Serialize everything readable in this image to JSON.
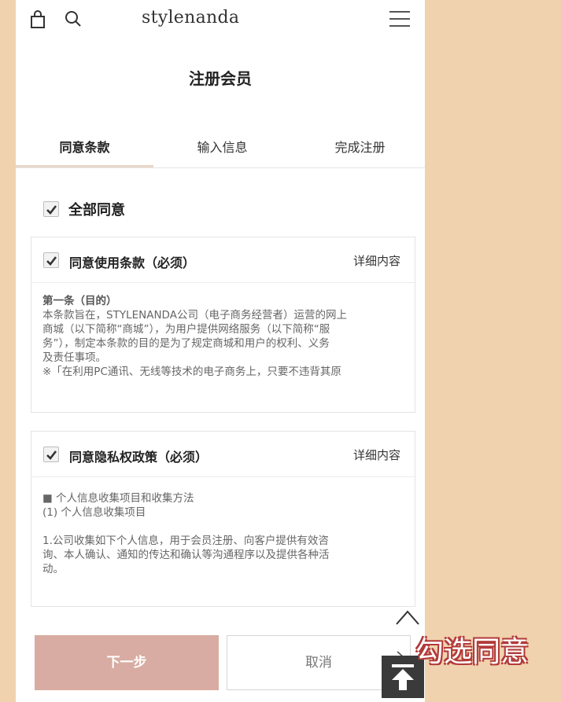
{
  "header": {
    "logo": "stylenanda"
  },
  "page_title": "注册会员",
  "tabs": [
    {
      "label": "同意条款"
    },
    {
      "label": "输入信息"
    },
    {
      "label": "完成注册"
    }
  ],
  "agree_all": {
    "label": "全部同意",
    "checked": true
  },
  "terms": {
    "label": "同意使用条款（必须）",
    "checked": true,
    "detail_link": "详细内容",
    "lines": [
      "第一条（目的）",
      "本条款旨在，STYLENANDA公司（电子商务经营者）运营的网上",
      "商城（以下简称“商城”），为用户提供网络服务（以下简称“服",
      "务”），制定本条款的目的是为了规定商城和用户的权利、义务",
      "及责任事项。",
      "※「在利用PC通讯、无线等技术的电子商务上，只要不违背其原"
    ]
  },
  "privacy": {
    "label": "同意隐私权政策（必须）",
    "checked": true,
    "detail_link": "详细内容",
    "lines": [
      "■ 个人信息收集项目和收集方法",
      "(1) 个人信息收集项目",
      "",
      "1.公司收集如下个人信息，用于会员注册、向客户提供有效咨",
      "询、本人确认、通知的传达和确认等沟通程序以及提供各种活",
      "动。"
    ]
  },
  "buttons": {
    "next": "下一步",
    "cancel": "取消"
  },
  "caption": "勾选同意",
  "colors": {
    "background": "#f1d2ae",
    "next_button": "#d8aca2",
    "caption_outline": "#b23a3a"
  }
}
